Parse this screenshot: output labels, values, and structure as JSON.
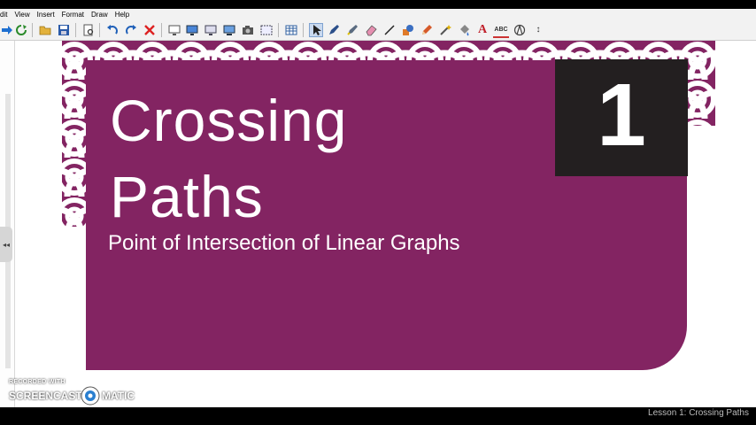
{
  "menu": [
    "dit",
    "View",
    "Insert",
    "Format",
    "Draw",
    "Help"
  ],
  "toolbar": {
    "icons": [
      "forward-arrow-icon",
      "refresh-icon",
      "open-folder-icon",
      "save-icon",
      "print-preview-icon",
      "undo-icon",
      "redo-icon",
      "delete-icon",
      "screen-icon",
      "monitor-icon",
      "display-icon",
      "computer-icon",
      "camera-icon",
      "screen-capture-icon",
      "table-icon",
      "select-arrow-icon",
      "pen-icon",
      "highlighter-icon",
      "eraser-icon",
      "line-icon",
      "shapes-icon",
      "pencil-icon",
      "magic-wand-icon",
      "fill-icon",
      "text-icon",
      "handwriting-icon",
      "compass-icon",
      "more-icon"
    ],
    "text_glyph": "A",
    "handwriting_glyph": "ABC",
    "more_glyph": "↕"
  },
  "sidebar": {
    "handle_glyph": "◂◂"
  },
  "slide": {
    "number": "1",
    "title_line1": "Crossing",
    "title_line2": "Paths",
    "subtitle": "Point of Intersection of Linear Graphs",
    "colors": {
      "panel": "#832462",
      "number_box": "#231f20",
      "text": "#ffffff"
    }
  },
  "status": {
    "text": "Lesson 1: Crossing Paths"
  },
  "watermark": {
    "recorded": "RECORDED WITH",
    "brand_left": "SCREENCAST",
    "brand_right": "MATIC"
  }
}
